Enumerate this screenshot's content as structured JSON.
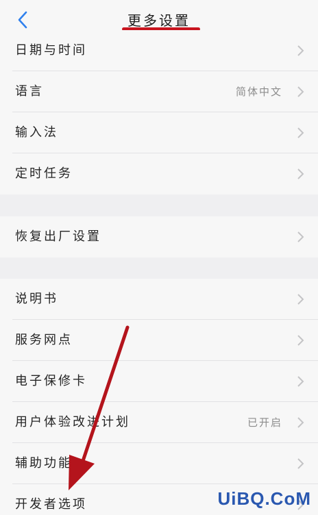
{
  "header": {
    "title": "更多设置",
    "back_icon": "chevron-left-icon"
  },
  "groups": [
    {
      "rows": [
        {
          "label": "日期与时间",
          "value": ""
        },
        {
          "label": "语言",
          "value": "简体中文"
        },
        {
          "label": "输入法",
          "value": ""
        },
        {
          "label": "定时任务",
          "value": ""
        }
      ]
    },
    {
      "rows": [
        {
          "label": "恢复出厂设置",
          "value": ""
        }
      ]
    },
    {
      "rows": [
        {
          "label": "说明书",
          "value": ""
        },
        {
          "label": "服务网点",
          "value": ""
        },
        {
          "label": "电子保修卡",
          "value": ""
        },
        {
          "label": "用户体验改进计划",
          "value": "已开启"
        },
        {
          "label": "辅助功能",
          "value": ""
        },
        {
          "label": "开发者选项",
          "value": ""
        }
      ]
    }
  ],
  "watermark": "UiBQ.CoM",
  "colors": {
    "accent": "#2f80ed",
    "annotation": "#c8141e",
    "background": "#efeff1",
    "row": "#f7f7f7"
  }
}
